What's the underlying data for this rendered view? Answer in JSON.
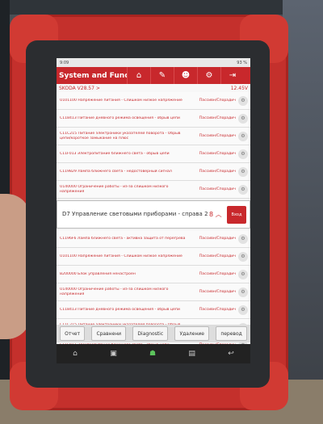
{
  "status_bar": {
    "time": "9:09",
    "battery": "93 %"
  },
  "app": {
    "title": "System and Functior"
  },
  "toolbar": {
    "home_icon": "home-icon",
    "report_icon": "clipboard-icon",
    "user_icon": "person-icon",
    "settings_icon": "gear-icon",
    "exit_icon": "exit-icon"
  },
  "breadcrumb": "SKODA V28.57 >",
  "voltage": "12.45V",
  "dtc_rows_top": [
    {
      "desc": "U101100 Напряжение питания - Слишком низкое напряжение",
      "status": "Пассивн/Спорадич"
    },
    {
      "desc": "C118413 Питание дневного режима освещения - обрыв цепи",
      "status": "Пассивн/Спорадич"
    },
    {
      "desc": "C11C215 Питание электроники указателей поворота - Обрыв цепи/короткое замыкание на плюс",
      "status": "Пассивн/Спорадич"
    },
    {
      "desc": "C11F013 Электропитание ближнего света - обрыв цепи",
      "status": "Пассивн/Спорадич"
    },
    {
      "desc": "C119829 Лампа ближнего света - недостоверный сигнал",
      "status": "Пассивн/Спорадич"
    },
    {
      "desc": "U140000 Ограничение работы - из-за слишком низкого напряжения",
      "status": "Пассивн/Спорадич"
    }
  ],
  "highlight": {
    "title": "D7 Управление световыми приборами - справа 2",
    "count": "8",
    "button": "Вход"
  },
  "dtc_rows_bottom": [
    {
      "desc": "C1196F6 Лампа ближнего света - активна защита от перегрева",
      "status": "Пассивн/Спорадич"
    },
    {
      "desc": "U101100 Напряжение питания - Слишком низкое напряжение",
      "status": "Пассивн/Спорадич"
    },
    {
      "desc": "B200000 Блок управления ненастроен",
      "status": "Пассивн/Спорадич"
    },
    {
      "desc": "U140000 Ограничение работы - из-за слишком низкого напряжения",
      "status": "Пассивн/Спорадич"
    },
    {
      "desc": "C118413 Питание дневного режима освещения - обрыв цепи",
      "status": "Пассивн/Спорадич"
    },
    {
      "desc": "C11C215 Питание электроники указателей поворота - Обрыв цепи/короткое замыкание на плюс",
      "status": "Пассивн/Спорадич"
    },
    {
      "desc": "C11F013 Электропитание ближнего света - обрыв цепи",
      "status": "Пассивн/Спорадич"
    }
  ],
  "actions": [
    "Отчет",
    "Сравнени",
    "Diagnostic",
    "Удаление",
    "перевод"
  ],
  "colors": {
    "accent": "#c8282c",
    "case": "#c4302c"
  }
}
